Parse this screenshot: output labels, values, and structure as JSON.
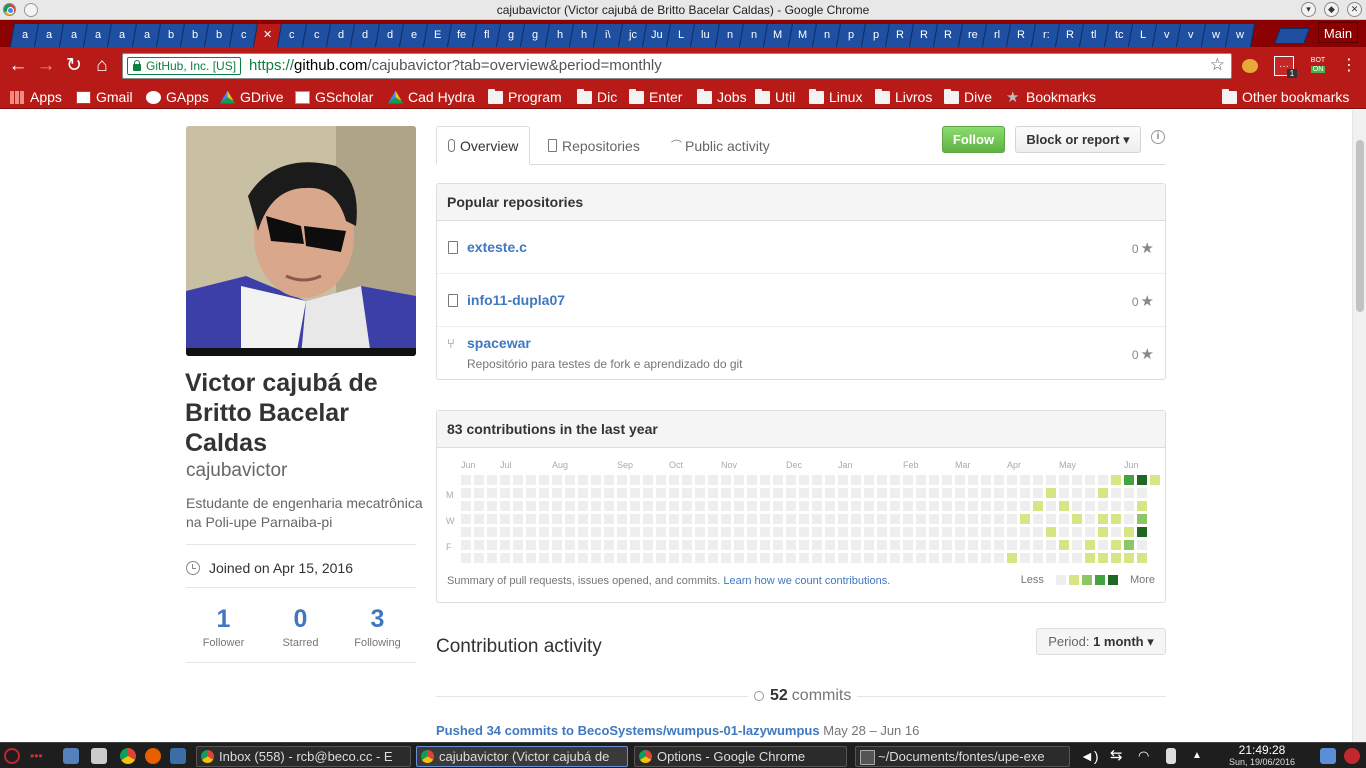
{
  "window": {
    "title": "cajubavictor (Victor cajubá de Britto Bacelar Caldas) - Google Chrome"
  },
  "tabs": [
    "a",
    "a",
    "a",
    "a",
    "a",
    "a",
    "b",
    "b",
    "b",
    "c",
    "",
    "c",
    "c",
    "d",
    "d",
    "d",
    "e",
    "E",
    "fe",
    "fl",
    "g",
    "g",
    "h",
    "h",
    "i\\",
    "jc",
    "Ju",
    "L",
    "lu",
    "n",
    "n",
    "M",
    "M",
    "n",
    "p",
    "p",
    "R",
    "R",
    "R",
    "re",
    "rl",
    "R",
    "r:",
    "R",
    "tl",
    "tc",
    "L",
    "v",
    "v",
    "w",
    "w"
  ],
  "active_tab_index": 10,
  "main_button": "Main",
  "omnibox": {
    "ev_label": "GitHub, Inc. [US]",
    "url_scheme": "https://",
    "url_host": "github.com",
    "url_path": "/cajubavictor?tab=overview&period=monthly"
  },
  "extensions": {
    "mail_badge": "1",
    "bot_label": "BOT",
    "bot_on": "ON"
  },
  "bookmarks": [
    "Apps",
    "Gmail",
    "GApps",
    "GDrive",
    "GScholar",
    "Cad Hydra",
    "Program",
    "Dic",
    "Enter",
    "Jobs",
    "Util",
    "Linux",
    "Livros",
    "Dive",
    "Bookmarks"
  ],
  "other_bookmarks": "Other bookmarks",
  "profile": {
    "fullname": "Victor cajubá de Britto Bacelar Caldas",
    "username": "cajubavictor",
    "bio": "Estudante de engenharia mecatrônica na Poli-upe Parnaiba-pi",
    "joined": "Joined on Apr 15, 2016",
    "stats": [
      {
        "value": "1",
        "label": "Follower"
      },
      {
        "value": "0",
        "label": "Starred"
      },
      {
        "value": "3",
        "label": "Following"
      }
    ]
  },
  "nav": {
    "overview": "Overview",
    "repositories": "Repositories",
    "activity": "Public activity"
  },
  "buttons": {
    "follow": "Follow",
    "block": "Block or report ▾",
    "info": "i"
  },
  "popular": {
    "title": "Popular repositories",
    "repos": [
      {
        "name": "exteste.c",
        "desc": "",
        "stars": "0",
        "fork": false
      },
      {
        "name": "info11-dupla07",
        "desc": "",
        "stars": "0",
        "fork": false
      },
      {
        "name": "spacewar",
        "desc": "Repositório para testes de fork e aprendizado do git",
        "stars": "0",
        "fork": true
      }
    ]
  },
  "contributions": {
    "title": "83 contributions in the last year",
    "months": [
      "Jun",
      "Jul",
      "Aug",
      "Sep",
      "Oct",
      "Nov",
      "Dec",
      "Jan",
      "Feb",
      "Mar",
      "Apr",
      "May",
      "Jun"
    ],
    "days": [
      "M",
      "W",
      "F"
    ],
    "summary": "Summary of pull requests, issues opened, and commits.",
    "learn_link": "Learn how we count contributions.",
    "legend_less": "Less",
    "legend_more": "More",
    "colors": [
      "#eeeeee",
      "#d6e685",
      "#8cc665",
      "#44a340",
      "#1e6823"
    ]
  },
  "activity": {
    "title": "Contribution activity",
    "period_label": "Period:",
    "period_value": "1 month ▾",
    "commits_count": "52",
    "commits_label": "commits",
    "pushed": "Pushed 34 commits to BecoSystems/wumpus-01-lazywumpus",
    "pushed_dates": "May 28 – Jun 16"
  },
  "taskbar": {
    "items": [
      "Inbox (558) - rcb@beco.cc - E",
      "cajubavictor (Victor cajubá de",
      "Options - Google Chrome",
      "~/Documents/fontes/upe-exe"
    ],
    "time": "21:49:28",
    "date": "Sun, 19/06/2016"
  }
}
